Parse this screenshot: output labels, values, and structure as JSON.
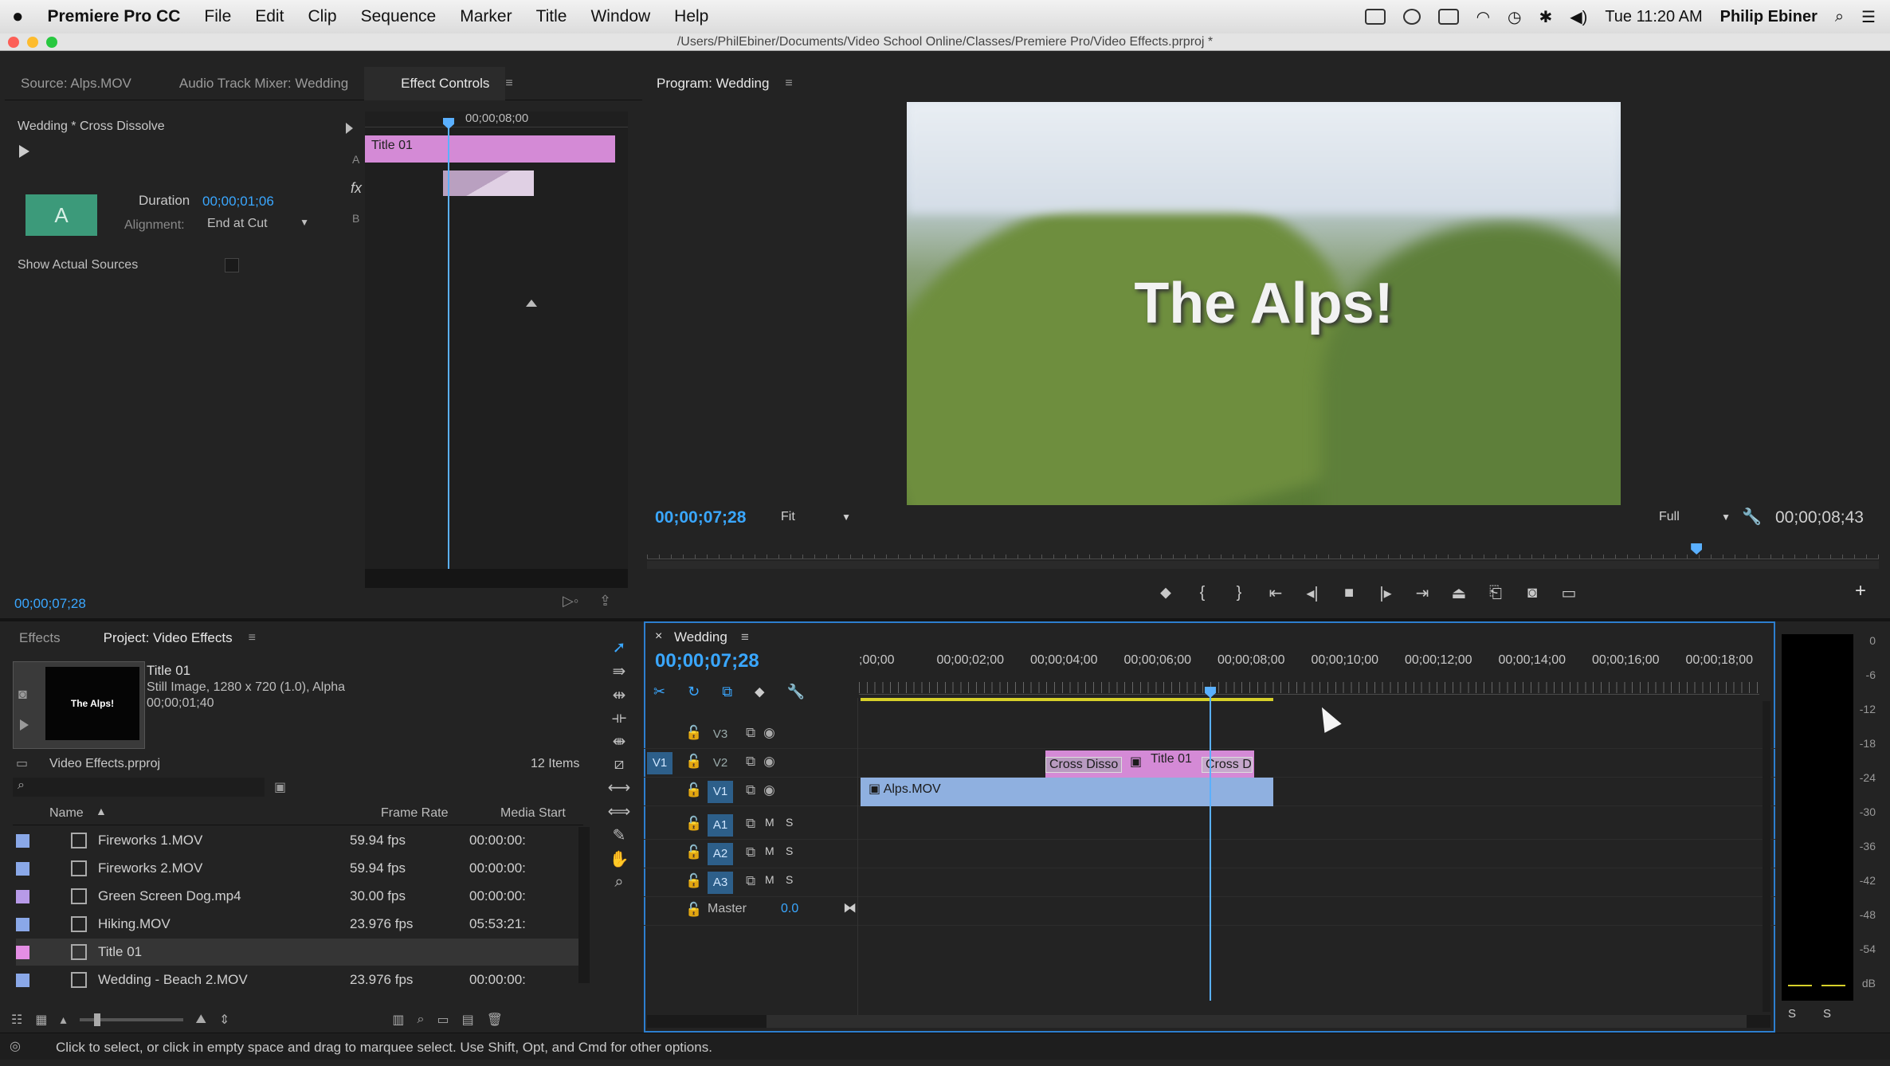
{
  "menubar": {
    "app_name": "Premiere Pro CC",
    "items": [
      "File",
      "Edit",
      "Clip",
      "Sequence",
      "Marker",
      "Title",
      "Window",
      "Help"
    ],
    "clock": "Tue 11:20 AM",
    "user": "Philip Ebiner"
  },
  "window": {
    "path": "/Users/PhilEbiner/Documents/Video School Online/Classes/Premiere Pro/Video Effects.prproj *"
  },
  "source_panel": {
    "tabs": [
      "Source: Alps.MOV",
      "Audio Track Mixer: Wedding",
      "Effect Controls"
    ],
    "heading": "Wedding * Cross Dissolve",
    "ruler_time": "00;00;08;00",
    "clip_label": "Title 01",
    "track_a": "A",
    "track_b": "B",
    "fx_label": "fx",
    "duration_label": "Duration",
    "duration_value": "00;00;01;06",
    "alignment_label": "Alignment:",
    "alignment_value": "End at Cut",
    "show_sources_label": "Show Actual Sources",
    "timecode": "00;00;07;28"
  },
  "program_monitor": {
    "tab": "Program: Wedding",
    "overlay_title": "The Alps!",
    "timecode": "00;00;07;28",
    "fit": "Fit",
    "quality": "Full",
    "duration": "00;00;08;43",
    "playhead_fraction": 0.852
  },
  "project_panel": {
    "tabs": [
      "Effects",
      "Project: Video Effects"
    ],
    "preview_name": "Title 01",
    "preview_desc": "Still Image, 1280 x 720 (1.0), Alpha",
    "preview_duration": "00;00;01;40",
    "thumb_text": "The Alps!",
    "project_file": "Video Effects.prproj",
    "item_count": "12 Items",
    "columns": [
      "Name",
      "Frame Rate",
      "Media Start"
    ],
    "rows": [
      {
        "name": "Fireworks 1.MOV",
        "rate": "59.94 fps",
        "start": "00:00:00:",
        "color": "#8aa8e8"
      },
      {
        "name": "Fireworks 2.MOV",
        "rate": "59.94 fps",
        "start": "00:00:00:",
        "color": "#8aa8e8"
      },
      {
        "name": "Green Screen Dog.mp4",
        "rate": "30.00 fps",
        "start": "00:00:00:",
        "color": "#b79ae8"
      },
      {
        "name": "Hiking.MOV",
        "rate": "23.976 fps",
        "start": "05:53:21:",
        "color": "#8aa8e8"
      },
      {
        "name": "Title 01",
        "rate": "",
        "start": "",
        "color": "#e48ee4"
      },
      {
        "name": "Wedding - Beach 2.MOV",
        "rate": "23.976 fps",
        "start": "00:00:00:",
        "color": "#8aa8e8"
      }
    ]
  },
  "timeline": {
    "tab": "Wedding",
    "timecode": "00;00;07;28",
    "ruler": [
      ";00;00",
      "00;00;02;00",
      "00;00;04;00",
      "00;00;06;00",
      "00;00;08;00",
      "00;00;10;00",
      "00;00;12;00",
      "00;00;14;00",
      "00;00;16;00",
      "00;00;18;00"
    ],
    "video_tracks": [
      "V3",
      "V2",
      "V1"
    ],
    "audio_tracks": [
      "A1",
      "A2",
      "A3"
    ],
    "source_patch": "V1",
    "mute": "M",
    "solo": "S",
    "master_label": "Master",
    "master_value": "0.0",
    "clips": {
      "v2_transition_a": "Cross Disso",
      "v2_title": "Title 01",
      "v2_transition_b": "Cross D",
      "v1_clip": "Alps.MOV"
    }
  },
  "meter": {
    "ticks": [
      "0",
      "-6",
      "-12",
      "-18",
      "-24",
      "-30",
      "-36",
      "-42",
      "-48",
      "-54",
      "dB"
    ],
    "solo_left": "S",
    "solo_right": "S"
  },
  "status_bar": "Click to select, or click in empty space and drag to marquee select. Use Shift, Opt, and Cmd for other options.",
  "colors": {
    "accent": "#3aa7ff",
    "title_clip": "#d48ad6",
    "video_clip": "#8fb0e0",
    "playhead": "#5ab0ff"
  }
}
